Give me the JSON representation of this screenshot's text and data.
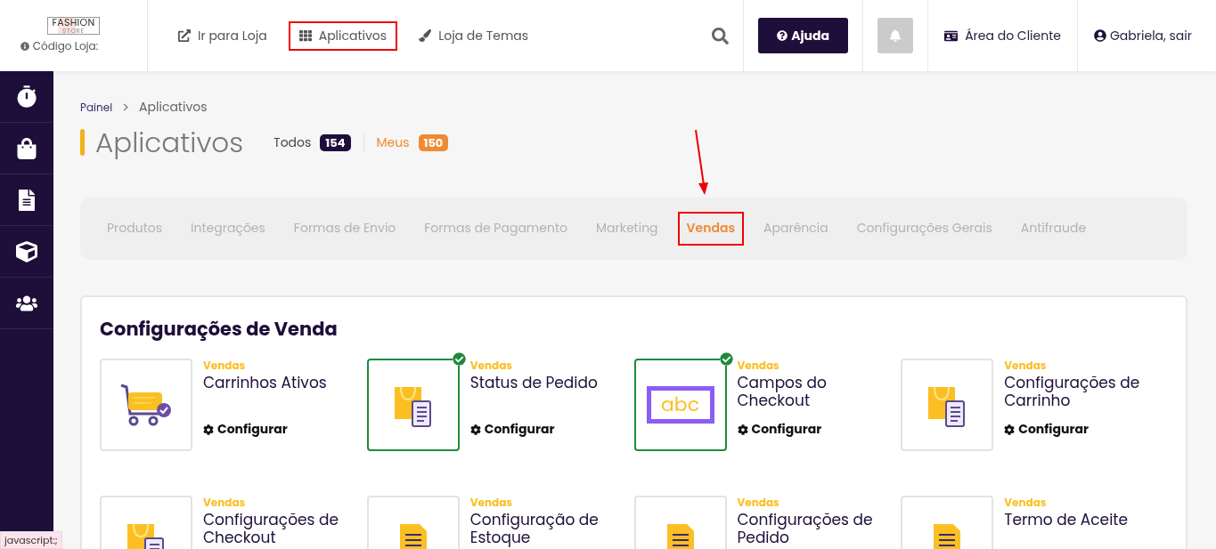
{
  "logo": {
    "line1": "FASHION",
    "line2": "STORE"
  },
  "store_code": "Código Loja:",
  "nav": [
    {
      "kind": "external",
      "label": "Ir para Loja",
      "highlighted": false
    },
    {
      "kind": "grid",
      "label": "Aplicativos",
      "highlighted": true
    },
    {
      "kind": "brush",
      "label": "Loja de Temas",
      "highlighted": false
    }
  ],
  "help_button": "Ajuda",
  "client_area": "Área do Cliente",
  "user": "Gabriela, sair",
  "sidebar": [
    {
      "kind": "dashboard"
    },
    {
      "kind": "bag"
    },
    {
      "kind": "document"
    },
    {
      "kind": "box"
    },
    {
      "kind": "users"
    }
  ],
  "breadcrumb": {
    "parent": "Painel",
    "current": "Aplicativos"
  },
  "title": "Aplicativos",
  "filters": [
    {
      "label": "Todos",
      "count": "154",
      "selected": true
    },
    {
      "label": "Meus",
      "count": "150",
      "selected": false
    }
  ],
  "tabs": [
    {
      "label": "Produtos",
      "selected": false,
      "highlighted": false
    },
    {
      "label": "Integrações",
      "selected": false,
      "highlighted": false
    },
    {
      "label": "Formas de Envio",
      "selected": false,
      "highlighted": false
    },
    {
      "label": "Formas de Pagamento",
      "selected": false,
      "highlighted": false
    },
    {
      "label": "Marketing",
      "selected": false,
      "highlighted": false
    },
    {
      "label": "Vendas",
      "selected": true,
      "highlighted": true
    },
    {
      "label": "Aparência",
      "selected": false,
      "highlighted": false
    },
    {
      "label": "Configurações Gerais",
      "selected": false,
      "highlighted": false
    },
    {
      "label": "Antifraude",
      "selected": false,
      "highlighted": false
    }
  ],
  "section_title": "Configurações de Venda",
  "apps": [
    {
      "category": "Vendas",
      "name": "Carrinhos Ativos",
      "kind": "cart",
      "installed": false,
      "action": "Configurar"
    },
    {
      "category": "Vendas",
      "name": "Status de Pedido",
      "kind": "bag",
      "installed": true,
      "action": "Configurar"
    },
    {
      "category": "Vendas",
      "name": "Campos do Checkout",
      "kind": "abc",
      "icon_text": "abc",
      "installed": true,
      "action": "Configurar"
    },
    {
      "category": "Vendas",
      "name": "Configurações de Carrinho",
      "kind": "bag",
      "installed": false,
      "action": "Configurar"
    },
    {
      "category": "Vendas",
      "name": "Configurações de Checkout",
      "kind": "bag",
      "installed": false
    },
    {
      "category": "Vendas",
      "name": "Configuração de Estoque",
      "kind": "doc",
      "installed": false
    },
    {
      "category": "Vendas",
      "name": "Configurações de Pedido",
      "kind": "doc",
      "installed": false
    },
    {
      "category": "Vendas",
      "name": "Termo de Aceite",
      "kind": "doc",
      "installed": false
    }
  ],
  "status_bar": "javascript:;"
}
